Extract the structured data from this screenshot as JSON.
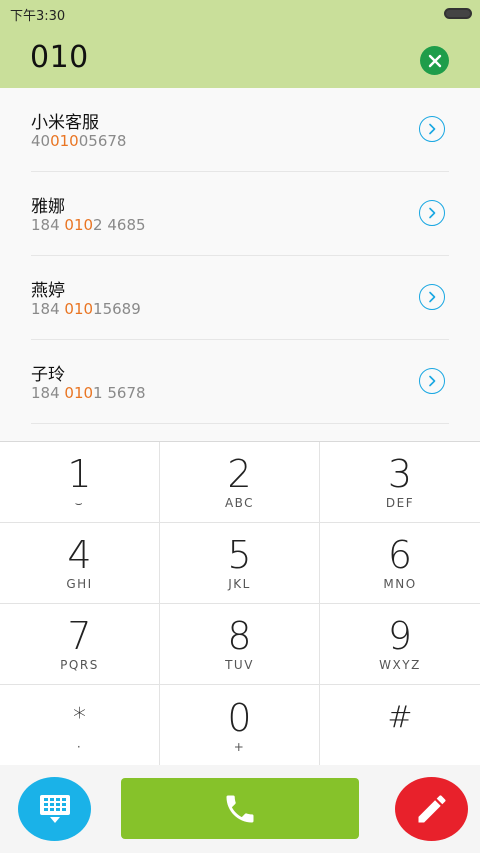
{
  "status_bar": {
    "time": "下午3:30"
  },
  "search": {
    "query": "010"
  },
  "results": [
    {
      "name": "小米客服",
      "number_pre": "40",
      "number_match": "010",
      "number_post": "05678"
    },
    {
      "name": "雅娜",
      "number_pre": "184 ",
      "number_match": "010",
      "number_post": "2 4685"
    },
    {
      "name": "燕婷",
      "number_pre": "184 ",
      "number_match": "010",
      "number_post": "15689"
    },
    {
      "name": "子玲",
      "number_pre": "184 ",
      "number_match": "010",
      "number_post": "1 5678"
    }
  ],
  "keypad": [
    {
      "digit": "1",
      "letters": "⌣"
    },
    {
      "digit": "2",
      "letters": "ABC"
    },
    {
      "digit": "3",
      "letters": "DEF"
    },
    {
      "digit": "4",
      "letters": "GHI"
    },
    {
      "digit": "5",
      "letters": "JKL"
    },
    {
      "digit": "6",
      "letters": "MNO"
    },
    {
      "digit": "7",
      "letters": "PQRS"
    },
    {
      "digit": "8",
      "letters": "TUV"
    },
    {
      "digit": "9",
      "letters": "WXYZ"
    },
    {
      "digit": "*",
      "letters": "·"
    },
    {
      "digit": "0",
      "letters": "+"
    },
    {
      "digit": "#",
      "letters": ""
    }
  ],
  "colors": {
    "header_green": "#c9df9a",
    "highlight_orange": "#e97523",
    "call_green": "#86c22a",
    "toggle_blue": "#1ab2e8",
    "edit_red": "#e8212b",
    "clear_green": "#1f9d4a"
  },
  "icons": {
    "clear": "close-icon",
    "detail": "chevron-right-icon",
    "dialpad": "dialpad-icon",
    "call": "phone-icon",
    "edit": "pencil-icon"
  }
}
